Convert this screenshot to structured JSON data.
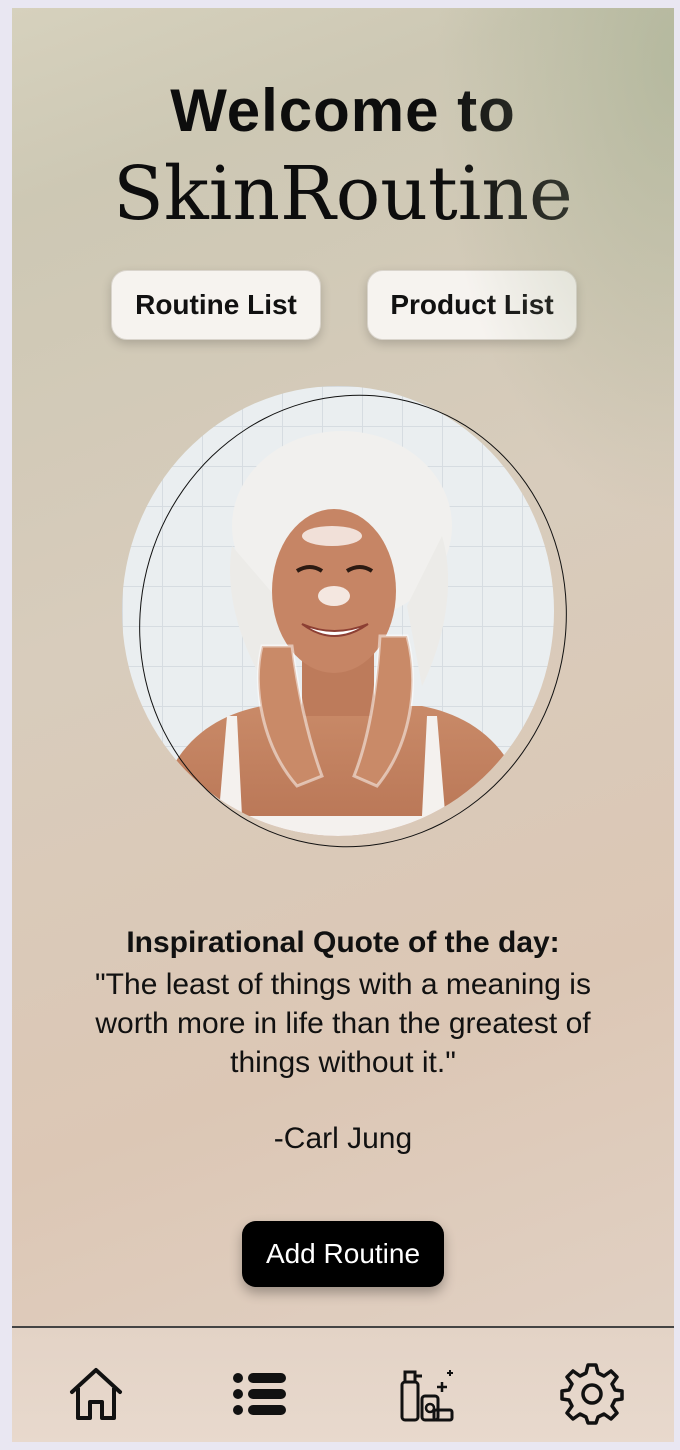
{
  "header": {
    "title_line1": "Welcome to",
    "title_line2": "SkinRoutine"
  },
  "nav_buttons": {
    "routine_list": "Routine List",
    "product_list": "Product List"
  },
  "quote": {
    "heading": "Inspirational Quote of the day:",
    "text": "\"The least of things with a meaning is worth more in life than the greatest of things without it.\"",
    "author": "-Carl Jung"
  },
  "actions": {
    "add_routine": "Add Routine"
  },
  "tabbar": {
    "icons": [
      "home-icon",
      "list-icon",
      "products-icon",
      "settings-icon"
    ]
  },
  "colors": {
    "primary_button": "#000000",
    "secondary_button": "#f6f3ef"
  }
}
